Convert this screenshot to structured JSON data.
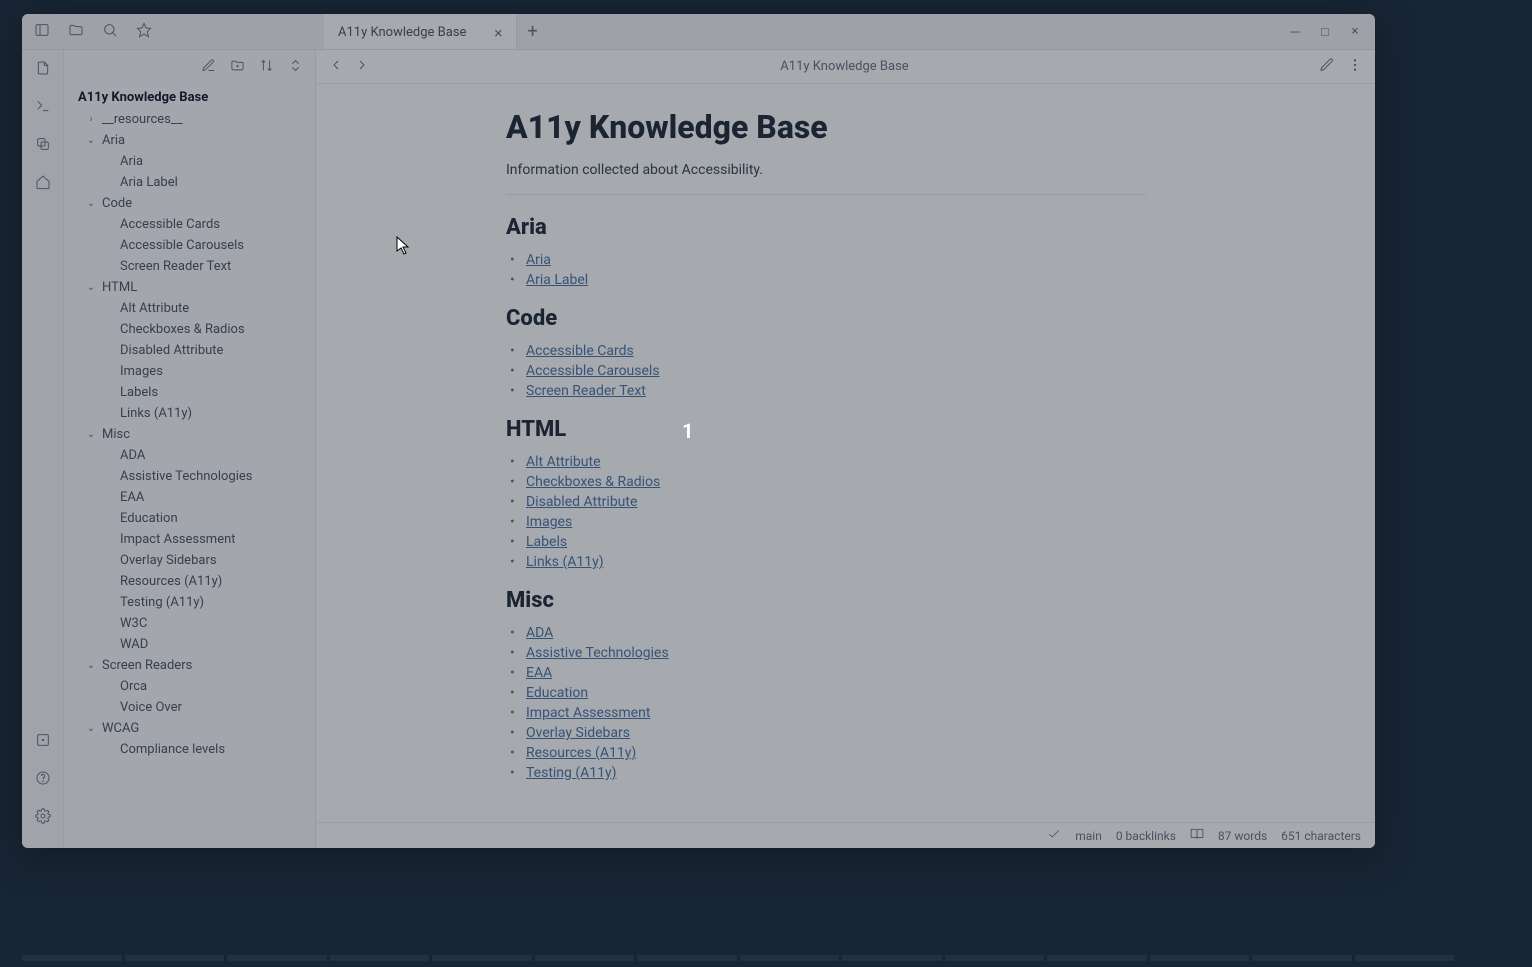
{
  "tab": {
    "title": "A11y Knowledge Base"
  },
  "toolbar": {
    "doc_title": "A11y Knowledge Base"
  },
  "sidebar": {
    "root": "A11y Knowledge Base",
    "items": [
      {
        "label": "__resources__",
        "expanded": false,
        "depth": 1
      },
      {
        "label": "Aria",
        "expanded": true,
        "depth": 1
      },
      {
        "label": "Aria",
        "depth": 2
      },
      {
        "label": "Aria Label",
        "depth": 2
      },
      {
        "label": "Code",
        "expanded": true,
        "depth": 1
      },
      {
        "label": "Accessible Cards",
        "depth": 2
      },
      {
        "label": "Accessible Carousels",
        "depth": 2
      },
      {
        "label": "Screen Reader Text",
        "depth": 2
      },
      {
        "label": "HTML",
        "expanded": true,
        "depth": 1
      },
      {
        "label": "Alt Attribute",
        "depth": 2
      },
      {
        "label": "Checkboxes & Radios",
        "depth": 2
      },
      {
        "label": "Disabled Attribute",
        "depth": 2
      },
      {
        "label": "Images",
        "depth": 2
      },
      {
        "label": "Labels",
        "depth": 2
      },
      {
        "label": "Links (A11y)",
        "depth": 2
      },
      {
        "label": "Misc",
        "expanded": true,
        "depth": 1
      },
      {
        "label": "ADA",
        "depth": 2
      },
      {
        "label": "Assistive Technologies",
        "depth": 2
      },
      {
        "label": "EAA",
        "depth": 2
      },
      {
        "label": "Education",
        "depth": 2
      },
      {
        "label": "Impact Assessment",
        "depth": 2
      },
      {
        "label": "Overlay Sidebars",
        "depth": 2
      },
      {
        "label": "Resources (A11y)",
        "depth": 2
      },
      {
        "label": "Testing (A11y)",
        "depth": 2
      },
      {
        "label": "W3C",
        "depth": 2
      },
      {
        "label": "WAD",
        "depth": 2
      },
      {
        "label": "Screen Readers",
        "expanded": true,
        "depth": 1
      },
      {
        "label": "Orca",
        "depth": 2
      },
      {
        "label": "Voice Over",
        "depth": 2
      },
      {
        "label": "WCAG",
        "expanded": true,
        "depth": 1
      },
      {
        "label": "Compliance levels",
        "depth": 2
      }
    ]
  },
  "document": {
    "title": "A11y Knowledge Base",
    "subtitle": "Information collected about Accessibility.",
    "sections": [
      {
        "heading": "Aria",
        "links": [
          "Aria",
          "Aria Label"
        ]
      },
      {
        "heading": "Code",
        "links": [
          "Accessible Cards",
          "Accessible Carousels",
          "Screen Reader Text"
        ]
      },
      {
        "heading": "HTML",
        "links": [
          "Alt Attribute",
          "Checkboxes & Radios",
          "Disabled Attribute",
          "Images",
          "Labels",
          "Links (A11y)"
        ]
      },
      {
        "heading": "Misc",
        "links": [
          "ADA",
          "Assistive Technologies",
          "EAA",
          "Education",
          "Impact Assessment",
          "Overlay Sidebars",
          "Resources (A11y)",
          "Testing (A11y)"
        ]
      }
    ]
  },
  "status": {
    "branch": "main",
    "backlinks": "0 backlinks",
    "words": "87 words",
    "chars": "651 characters"
  },
  "marker": "1"
}
